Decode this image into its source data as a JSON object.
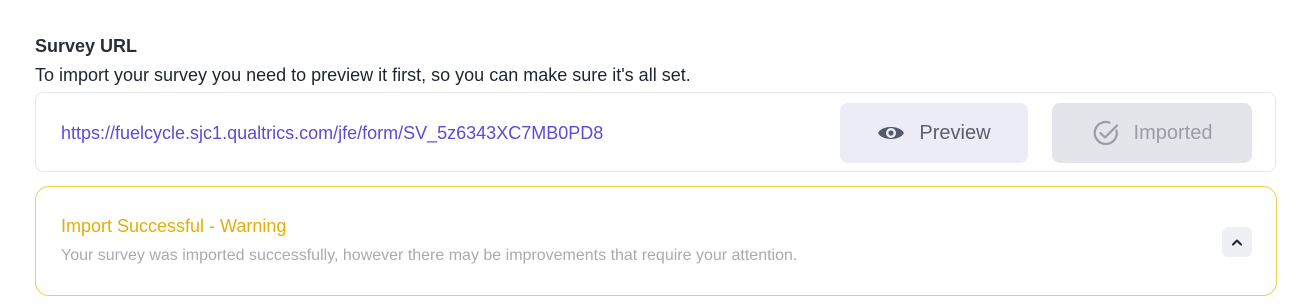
{
  "section": {
    "title": "Survey URL",
    "description": "To import your survey you need to preview it first, so you can make sure it's all set."
  },
  "url_card": {
    "url": "https://fuelcycle.sjc1.qualtrics.com/jfe/form/SV_5z6343XC7MB0PD8",
    "preview_button": {
      "label": "Preview",
      "icon": "eye-icon"
    },
    "imported_button": {
      "label": "Imported",
      "icon": "check-circle-icon",
      "state": "disabled"
    }
  },
  "alert": {
    "title": "Import Successful - Warning",
    "message": "Your survey was imported successfully, however there may be improvements that require your attention.",
    "toggle_icon": "chevron-up-icon",
    "expanded": true
  },
  "colors": {
    "accent": "#5d4bd6",
    "warning": "#e3ae09",
    "warning_border": "#f0cf4a"
  }
}
